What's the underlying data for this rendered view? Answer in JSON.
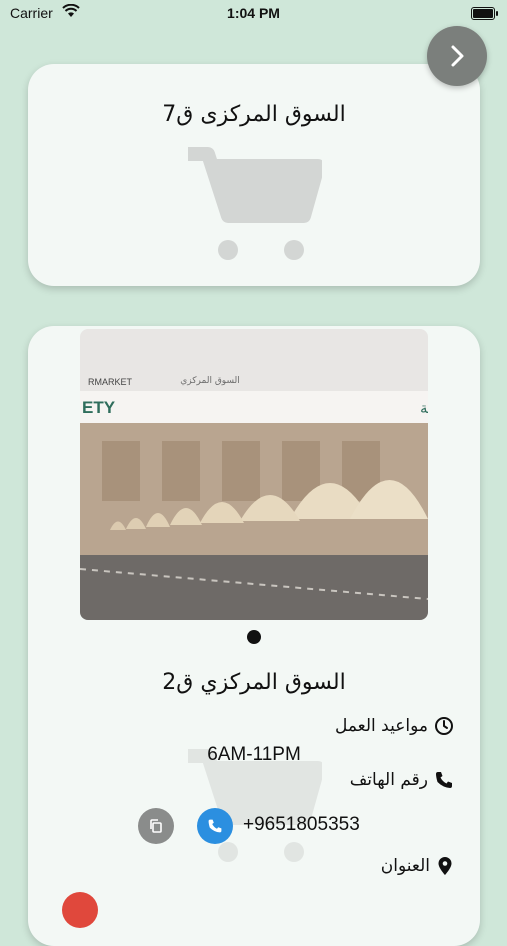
{
  "status_bar": {
    "carrier": "Carrier",
    "time": "1:04 PM"
  },
  "cards": [
    {
      "title": "السوق المركزى ق7"
    },
    {
      "title": "السوق المركزي ق2",
      "photo_caption_sign": "جمعية الجابرية التعاونية",
      "photo_caption_top": "السوق المركزي",
      "photo_caption_left_1": "RMARKET",
      "photo_caption_left_2": "ETY",
      "hours_label": "مواعيد العمل",
      "hours_value": "6AM-11PM",
      "phone_label": "رقم الهاتف",
      "phone_value": "+9651805353",
      "address_label": "العنوان"
    }
  ],
  "colors": {
    "background": "#cfe7d9",
    "card": "#f3f8f5",
    "call": "#2b8fe0",
    "copy": "#8a8c8b",
    "next": "#7b7f7c"
  }
}
